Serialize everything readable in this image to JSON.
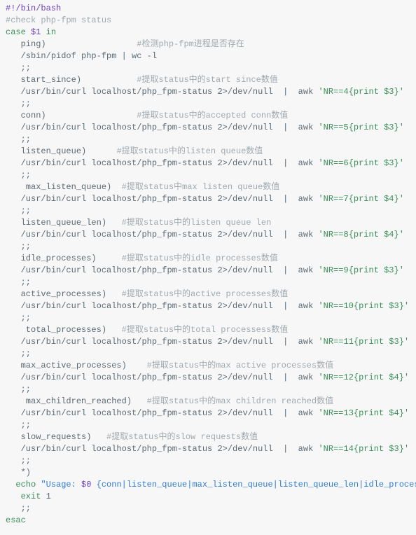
{
  "code": {
    "shebang": "#!/bin/bash",
    "comment_header": "#check php-fpm status",
    "case_kw": "case",
    "case_arg": "$1",
    "in_kw": "in",
    "cases": [
      {
        "label": "ping)",
        "label_comment": "#检测php-fpm进程是否存在",
        "body_plain": "/sbin/pidof php-fpm | wc -l"
      },
      {
        "label": "start_since)",
        "label_comment": "#提取status中的start since数值",
        "body_curl": "/usr/bin/curl localhost/php_fpm-status 2",
        "body_devnull": ">/dev/null",
        "body_pipe": "  |  awk ",
        "body_awk": "'NR==4{print $3}'"
      },
      {
        "label": "conn)",
        "label_comment": "#提取status中的accepted conn数值",
        "body_curl": "/usr/bin/curl localhost/php_fpm-status 2",
        "body_devnull": ">/dev/null",
        "body_pipe": "  |  awk ",
        "body_awk": "'NR==5{print $3}'"
      },
      {
        "label": "listen_queue)",
        "label_comment": "#提取status中的listen queue数值",
        "label_pad": "      ",
        "body_curl": "/usr/bin/curl localhost/php_fpm-status 2",
        "body_devnull": ">/dev/null",
        "body_pipe": "  |  awk ",
        "body_awk": "'NR==6{print $3}'"
      },
      {
        "label": " max_listen_queue)",
        "label_comment": "#提取status中max listen queue数值",
        "label_pad": "  ",
        "body_curl": "/usr/bin/curl localhost/php_fpm-status 2",
        "body_devnull": ">/dev/null",
        "body_pipe": "  |  awk ",
        "body_awk": "'NR==7{print $4}'"
      },
      {
        "label": "listen_queue_len)",
        "label_comment": "#提取status中的listen queue len",
        "label_pad": "   ",
        "body_curl": "/usr/bin/curl localhost/php_fpm-status 2",
        "body_devnull": ">/dev/null",
        "body_pipe": "  |  awk ",
        "body_awk": "'NR==8{print $4}'"
      },
      {
        "label": "idle_processes)",
        "label_comment": "#提取status中的idle processes数值",
        "label_pad": "     ",
        "body_curl": "/usr/bin/curl localhost/php_fpm-status 2",
        "body_devnull": ">/dev/null",
        "body_pipe": "  |  awk ",
        "body_awk": "'NR==9{print $3}'"
      },
      {
        "label": "active_processes)",
        "label_comment": "#提取status中的active processes数值",
        "label_pad": "   ",
        "body_curl": "/usr/bin/curl localhost/php_fpm-status 2",
        "body_devnull": ">/dev/null",
        "body_pipe": "  |  awk ",
        "body_awk": "'NR==10{print $3}'"
      },
      {
        "label": " total_processes)",
        "label_comment": "#提取status中的total processess数值",
        "label_pad": "   ",
        "body_curl": "/usr/bin/curl localhost/php_fpm-status 2",
        "body_devnull": ">/dev/null",
        "body_pipe": "  |  awk ",
        "body_awk": "'NR==11{print $3}'"
      },
      {
        "label": "max_active_processes)",
        "label_comment": "#提取status中的max active processes数值",
        "label_pad": "    ",
        "body_curl": "/usr/bin/curl localhost/php_fpm-status 2",
        "body_devnull": ">/dev/null",
        "body_pipe": "  |  awk ",
        "body_awk": "'NR==12{print $4}'"
      },
      {
        "label": " max_children_reached)",
        "label_comment": "#提取status中的max children reached数值",
        "label_pad": "   ",
        "body_curl": "/usr/bin/curl localhost/php_fpm-status 2",
        "body_devnull": ">/dev/null",
        "body_pipe": "  |  awk ",
        "body_awk": "'NR==13{print $4}'"
      },
      {
        "label": "slow_requests)",
        "label_comment": "#提取status中的slow requests数值",
        "label_pad": "   ",
        "body_curl": "/usr/bin/curl localhost/php_fpm-status 2",
        "body_devnull": ">/dev/null",
        "body_pipe": "  |  awk ",
        "body_awk": "'NR==14{print $3}'"
      }
    ],
    "default_label": "*)",
    "echo_kw": "echo",
    "usage_prefix": "\"Usage: ",
    "usage_var": "$0",
    "usage_rest": " {conn|listen_queue|max_listen_queue|listen_queue_len|idle_processes|active_processess|total_processes|max_active_processes|max_children_reached|slow_requests}\"",
    "exit_kw": "exit",
    "exit_code": "1",
    "term": ";;",
    "esac_kw": "esac",
    "indent1": "   ",
    "indent2": "   "
  }
}
